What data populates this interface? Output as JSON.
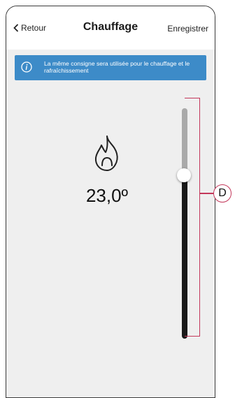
{
  "header": {
    "back_label": "Retour",
    "title": "Chauffage",
    "save_label": "Enregistrer"
  },
  "banner": {
    "message": "La même consigne sera utilisée pour le chauffage et le rafraîchissement",
    "color": "#3d8bc8",
    "icon": "info-icon"
  },
  "mode_icon": "flame-icon",
  "temperature": {
    "value_label": "23,0º"
  },
  "slider": {
    "level_fraction": 0.74,
    "color_active": "#1a1a1a",
    "color_inactive": "#a9a9a9"
  },
  "callout": {
    "label": "D",
    "color": "#c3375a"
  }
}
